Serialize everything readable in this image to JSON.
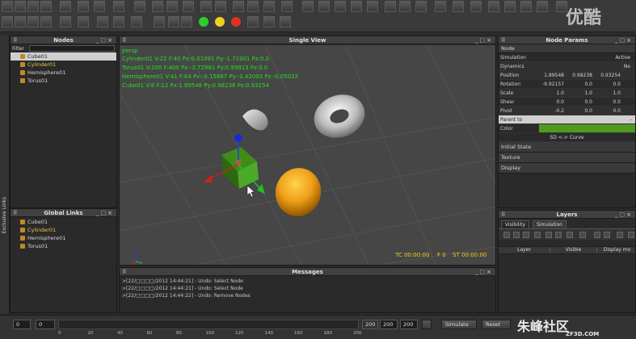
{
  "watermark_top": "优酷",
  "watermark_bottom": "朱峰社区",
  "watermark_bottom_sub": "ZF3D.COM",
  "toolbar": {
    "circle_colors": [
      "#2ecc2e",
      "#f0d020",
      "#e03020"
    ]
  },
  "nodes_panel": {
    "title": "Nodes",
    "filter_label": "Filter",
    "items": [
      {
        "label": "Cube01",
        "state": "selected"
      },
      {
        "label": "Cylinder01",
        "state": "highlight"
      },
      {
        "label": "Hemisphere01",
        "state": "normal"
      },
      {
        "label": "Torus01",
        "state": "normal"
      }
    ]
  },
  "side_strip_label": "Exclusive Links",
  "global_links": {
    "title": "Global Links",
    "items": [
      {
        "label": "Cube01",
        "state": "normal"
      },
      {
        "label": "Cylinder01",
        "state": "highlight"
      },
      {
        "label": "Hemisphere01",
        "state": "normal"
      },
      {
        "label": "Torus01",
        "state": "normal"
      }
    ]
  },
  "viewport": {
    "title": "Single View",
    "camera": "persp",
    "info_lines": [
      "Cylinder01 V:22 F:40 Px:0.01091 Py:-1.71901 Pz:0.0",
      "Torus01 V:200 F:400 Px:-3.72981 Py:0.99913 Pz:0.0",
      "Hemisphere01 V:41 F:64 Px:-0.15887 Py:-2.42093 Pz:-0.05032",
      "Cube01 V:8 F:12 Px:1.89548 Py:0.98238 Pz:0.93254"
    ],
    "tc": "TC 00:00:00",
    "f": "F 0",
    "st": "ST 00:00:00"
  },
  "node_params": {
    "title": "Node Params",
    "section_node": "Node",
    "simulation_label": "Simulation",
    "simulation_value": "Active",
    "dynamics_label": "Dynamics",
    "dynamics_value": "No",
    "rows": [
      {
        "label": "Position",
        "values": [
          "1.89548",
          "0.98238",
          "0.93254"
        ]
      },
      {
        "label": "Rotation",
        "values": [
          "-9.92157",
          "0.0",
          "0.0"
        ]
      },
      {
        "label": "Scale",
        "values": [
          "1.0",
          "1.0",
          "1.0"
        ]
      },
      {
        "label": "Shear",
        "values": [
          "0.0",
          "0.0",
          "0.0"
        ]
      },
      {
        "label": "Pivot",
        "values": [
          "-0.2",
          "0.0",
          "0.0"
        ]
      }
    ],
    "parent_to_label": "Parent to",
    "color_label": "Color",
    "color_value": "#4f9a1c",
    "sd_curve": "SD <-> Curve",
    "sections": [
      "Initial State",
      "Texture",
      "Display"
    ]
  },
  "layers": {
    "title": "Layers",
    "tabs": [
      "Visibility",
      "Simulation"
    ],
    "columns": [
      "Layer",
      "Visible",
      "Display mo"
    ]
  },
  "messages": {
    "title": "Messages",
    "lines": [
      ">[22/□□□□/2012 14:44:21] - Undo: Select Node",
      ">[22/□□□□/2012 14:44:21] - Undo: Select Node",
      ">[22/□□□□/2012 14:44:22] - Undo: Remove Nodes"
    ]
  },
  "timeline": {
    "start": "0",
    "current": "0",
    "ticks": [
      "0",
      "20",
      "40",
      "60",
      "80",
      "100",
      "120",
      "140",
      "160",
      "180",
      "200"
    ],
    "end_a": "200",
    "end_b": "200",
    "end_c": "200",
    "simulate_label": "Simulate",
    "reset_label": "Reset"
  }
}
